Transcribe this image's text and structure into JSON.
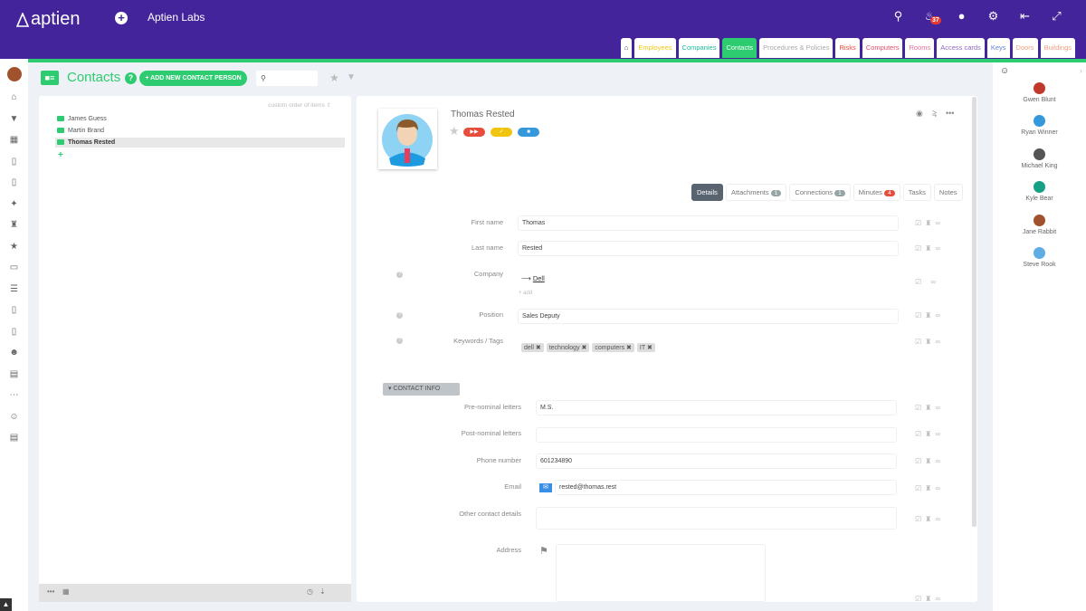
{
  "app": {
    "logo_text": "aptien",
    "org_name": "Aptien Labs",
    "notif_count": "37"
  },
  "icons": {
    "search": "search-icon",
    "bell": "bell-icon",
    "chat": "chat-icon",
    "gear": "gear-icon",
    "logout": "logout-icon",
    "collapse": "collapse-icon"
  },
  "tabs": [
    {
      "label": "Employees",
      "color": "#f5c518"
    },
    {
      "label": "Companies",
      "color": "#1abc9c"
    },
    {
      "label": "Contacts",
      "color": "#ffffff"
    },
    {
      "label": "Procedures & Policies",
      "color": "#aaaaaa"
    },
    {
      "label": "Risks",
      "color": "#e74c3c"
    },
    {
      "label": "Computers",
      "color": "#e74c6c"
    },
    {
      "label": "Rooms",
      "color": "#e57398"
    },
    {
      "label": "Access cards",
      "color": "#8e6cbf"
    },
    {
      "label": "Keys",
      "color": "#6c7fd9"
    },
    {
      "label": "Doors",
      "color": "#f0a080"
    },
    {
      "label": "Buildings",
      "color": "#f0a080"
    }
  ],
  "page": {
    "title": "Contacts",
    "add_button": "+ ADD NEW CONTACT PERSON",
    "help": "?"
  },
  "list": {
    "order_label": "custom order of items",
    "items": [
      {
        "label": "James Guess"
      },
      {
        "label": "Martin Brand"
      },
      {
        "label": "Thomas Rested"
      }
    ]
  },
  "detail": {
    "name": "Thomas Rested",
    "tabs": [
      {
        "label": "Details"
      },
      {
        "label": "Attachments",
        "count": "1"
      },
      {
        "label": "Connections",
        "count": "1"
      },
      {
        "label": "Minutes",
        "count": "4"
      },
      {
        "label": "Tasks"
      },
      {
        "label": "Notes"
      }
    ],
    "fields": {
      "first_name_label": "First name",
      "first_name": "Thomas",
      "last_name_label": "Last name",
      "last_name": "Rested",
      "company_label": "Company",
      "company": "Dell",
      "add_link": "+ add",
      "position_label": "Position",
      "position": "Sales Deputy",
      "tags_label": "Keywords / Tags",
      "tags": [
        "dell",
        "technology",
        "computers",
        "IT"
      ]
    },
    "section_label": "CONTACT INFO",
    "contact": {
      "pre_label": "Pre-nominal letters",
      "pre": "M.S.",
      "post_label": "Post-nominal letters",
      "post": "",
      "phone_label": "Phone number",
      "phone": "601234890",
      "email_label": "Email",
      "email": "rested@thomas.rest",
      "other_label": "Other contact details",
      "other": "",
      "address_label": "Address"
    }
  },
  "people": [
    {
      "name": "Gwen Blunt",
      "color": "#c0392b"
    },
    {
      "name": "Ryan Winner",
      "color": "#3498db"
    },
    {
      "name": "Michael King",
      "color": "#555555"
    },
    {
      "name": "Kyle Bear",
      "color": "#16a085"
    },
    {
      "name": "Jane Rabbit",
      "color": "#a0522d"
    },
    {
      "name": "Steve Rook",
      "color": "#5dade2"
    }
  ]
}
